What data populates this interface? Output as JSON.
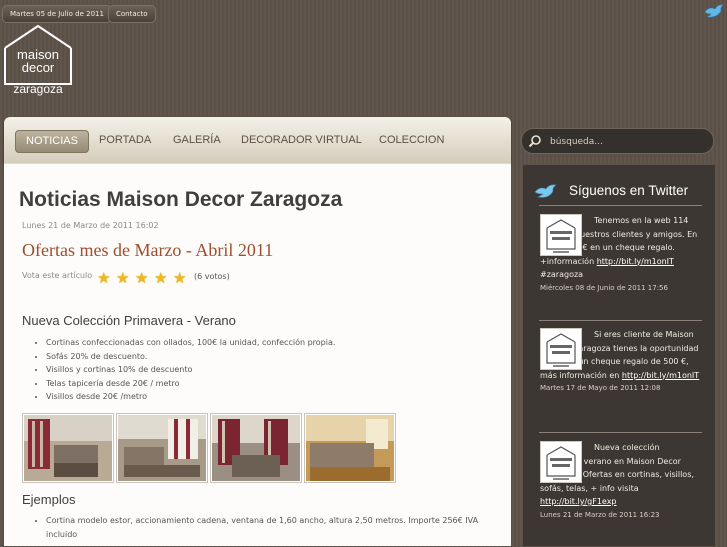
{
  "header": {
    "date_pill": "Martes 05 de Julio de 2011",
    "contact_pill": "Contacto",
    "logo": {
      "line1": "maison",
      "line2": "decor",
      "city": "zaragoza"
    }
  },
  "nav": {
    "items": [
      {
        "label": "NOTICIAS",
        "active": true
      },
      {
        "label": "PORTADA",
        "active": false
      },
      {
        "label": "GALERÍA",
        "active": false
      },
      {
        "label": "DECORADOR VIRTUAL",
        "active": false
      },
      {
        "label": "COLECCION",
        "active": false
      }
    ]
  },
  "search": {
    "placeholder": "búsqueda..."
  },
  "main": {
    "page_title": "Noticias Maison Decor Zaragoza",
    "date": "Lunes 21 de Marzo de 2011 16:02",
    "article_title": "Ofertas mes de Marzo - Abril 2011",
    "vote_label": "Vota este artículo",
    "rating_stars": 5,
    "vote_count": "(6 votos)",
    "section1_heading": "Nueva Colección Primavera - Verano",
    "section1_items": [
      "Cortinas confeccionadas con ollados, 100€ la unidad, confección propia.",
      "Sofás 20% de descuento.",
      "Visillos y cortinas 10% de descuento",
      "Telas tapicería desde 20€ / metro",
      "Visillos desde 20€ /metro"
    ],
    "section2_heading": "Ejemplos",
    "section2_items": [
      "Cortina modelo estor, accionamiento cadena, ventana de 1,60 ancho, altura 2,50 metros. Importe 256€ IVA incluido"
    ]
  },
  "sidebar": {
    "twitter_title": "Síguenos en Twitter",
    "tweets": [
      {
        "text": "Tenemos en la web 114 fotos de nuestros clientes y amigos. En juego 500 € en un cheque regalo. +información",
        "link": "http://bit.ly/m1onIT",
        "tail": "#zaragoza",
        "date": "Miércoles 08 de Junio de 2011 17:56"
      },
      {
        "text": "Si eres cliente de Maison Decor #Zaragoza tienes la oportunidad de ganar un cheque regalo de 500 €, más información en",
        "link": "http://bit.ly/m1onIT",
        "tail": "",
        "date": "Martes 17 de Mayo de 2011 12:08"
      },
      {
        "text": "Nueva colección primavera verano en Maison Decor Zaragoza. Ofertas en cortinas, visillos, sofás, telas, + info visita",
        "link": "http://bit.ly/gF1exp",
        "tail": "",
        "date": "Lunes 21 de Marzo de 2011 16:23"
      }
    ]
  },
  "colors": {
    "accent_title": "#9d4e2c",
    "star": "#f0b81c",
    "background": "#5d5248",
    "sidebar": "#3c3732"
  }
}
